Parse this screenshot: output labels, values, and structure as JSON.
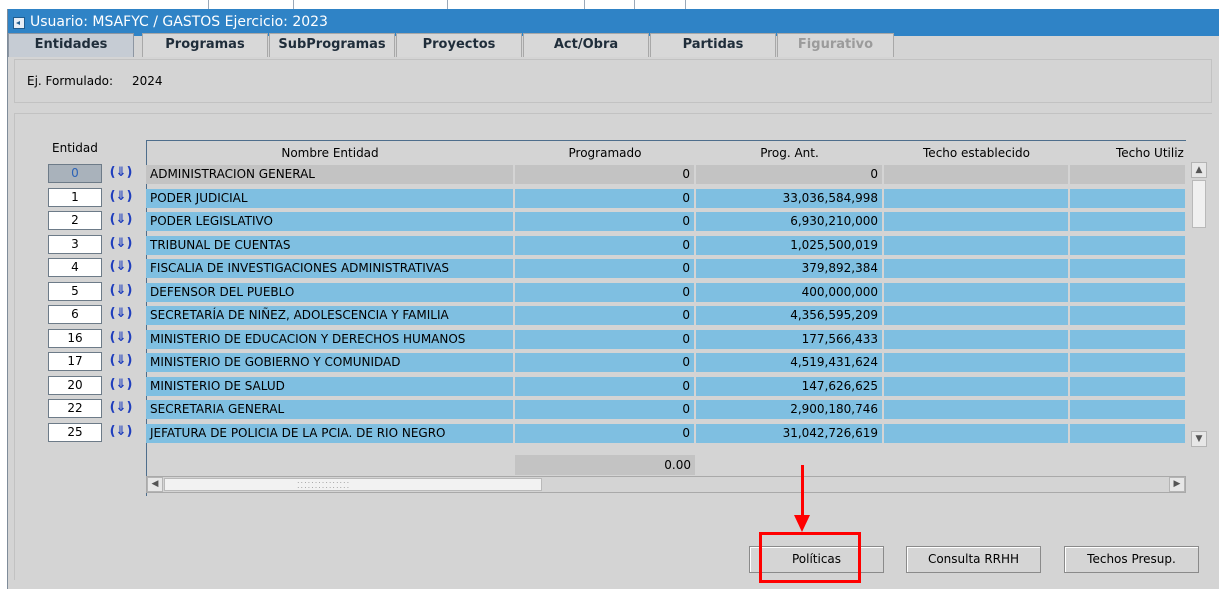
{
  "window": {
    "title": "Usuario: MSAFYC  /  GASTOS  Ejercicio: 2023"
  },
  "tabs": [
    {
      "label": "Entidades",
      "state": "active"
    },
    {
      "label": "Programas",
      "state": "normal"
    },
    {
      "label": "SubProgramas",
      "state": "normal"
    },
    {
      "label": "Proyectos",
      "state": "normal"
    },
    {
      "label": "Act/Obra",
      "state": "normal"
    },
    {
      "label": "Partidas",
      "state": "normal"
    },
    {
      "label": "Figurativo",
      "state": "disabled"
    }
  ],
  "formulado": {
    "label": "Ej. Formulado:",
    "value": "2024"
  },
  "grid": {
    "id_header": "Entidad",
    "columns": [
      "Nombre Entidad",
      "Programado",
      "Prog. Ant.",
      "Techo establecido",
      "Techo Utiliz"
    ],
    "download_icon": "download-icon",
    "rows": [
      {
        "id": "0",
        "nombre": "ADMINISTRACION GENERAL",
        "programado": "0",
        "prog_ant": "0"
      },
      {
        "id": "1",
        "nombre": "PODER JUDICIAL",
        "programado": "0",
        "prog_ant": "33,036,584,998"
      },
      {
        "id": "2",
        "nombre": "PODER LEGISLATIVO",
        "programado": "0",
        "prog_ant": "6,930,210,000"
      },
      {
        "id": "3",
        "nombre": "TRIBUNAL DE CUENTAS",
        "programado": "0",
        "prog_ant": "1,025,500,019"
      },
      {
        "id": "4",
        "nombre": "FISCALIA DE INVESTIGACIONES ADMINISTRATIVAS",
        "programado": "0",
        "prog_ant": "379,892,384"
      },
      {
        "id": "5",
        "nombre": "DEFENSOR DEL PUEBLO",
        "programado": "0",
        "prog_ant": "400,000,000"
      },
      {
        "id": "6",
        "nombre": "SECRETARÍA DE NIÑEZ, ADOLESCENCIA Y FAMILIA",
        "programado": "0",
        "prog_ant": "4,356,595,209"
      },
      {
        "id": "16",
        "nombre": "MINISTERIO DE EDUCACION Y DERECHOS HUMANOS",
        "programado": "0",
        "prog_ant": "177,566,433"
      },
      {
        "id": "17",
        "nombre": "MINISTERIO DE GOBIERNO Y COMUNIDAD",
        "programado": "0",
        "prog_ant": "4,519,431,624"
      },
      {
        "id": "20",
        "nombre": "MINISTERIO DE SALUD",
        "programado": "0",
        "prog_ant": "147,626,625"
      },
      {
        "id": "22",
        "nombre": "SECRETARIA GENERAL",
        "programado": "0",
        "prog_ant": "2,900,180,746"
      },
      {
        "id": "25",
        "nombre": "JEFATURA DE POLICIA DE LA PCIA. DE RIO NEGRO",
        "programado": "0",
        "prog_ant": "31,042,726,619"
      }
    ],
    "total_programado": "0.00"
  },
  "buttons": {
    "politicas": "Políticas",
    "consulta_rrhh": "Consulta RRHH",
    "techos_presup": "Techos Presup."
  },
  "colors": {
    "titlebar": "#2f83c6",
    "row_fill": "#7fbfe1",
    "annotation": "#ff0000"
  }
}
